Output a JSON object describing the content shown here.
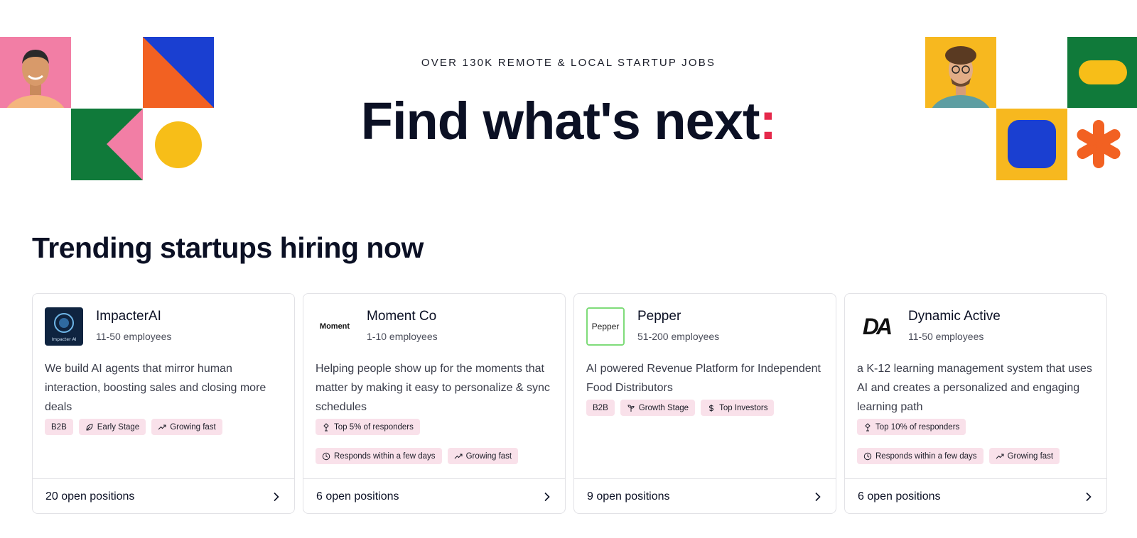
{
  "hero": {
    "eyebrow": "OVER 130K REMOTE & LOCAL STARTUP JOBS",
    "title": "Find what's next",
    "title_colon": ":",
    "accent_color": "#e5294b"
  },
  "section": {
    "title": "Trending startups hiring now"
  },
  "cards": [
    {
      "name": "ImpacterAI",
      "size": "11-50 employees",
      "logo_text": "Impacter AI",
      "description": "We build AI agents that mirror human interaction, boosting sales and closing more deals",
      "tags": [
        {
          "icon": "none",
          "label": "B2B"
        },
        {
          "icon": "leaf-icon",
          "label": "Early Stage"
        },
        {
          "icon": "trending-up-icon",
          "label": "Growing fast"
        }
      ],
      "open_positions": "20 open positions"
    },
    {
      "name": "Moment Co",
      "size": "1-10 employees",
      "logo_text": "Moment",
      "description": "Helping people show up for the moments that matter by making it easy to personalize & sync schedules",
      "tags": [
        {
          "icon": "award-icon",
          "label": "Top 5% of responders"
        },
        {
          "icon": "clock-icon",
          "label": "Responds within a few days"
        },
        {
          "icon": "trending-up-icon",
          "label": "Growing fast"
        }
      ],
      "open_positions": "6 open positions"
    },
    {
      "name": "Pepper",
      "size": "51-200 employees",
      "logo_text": "Pepper",
      "description": "AI powered Revenue Platform for Independent Food Distributors",
      "tags": [
        {
          "icon": "none",
          "label": "B2B"
        },
        {
          "icon": "sprout-icon",
          "label": "Growth Stage"
        },
        {
          "icon": "dollar-icon",
          "label": "Top Investors"
        }
      ],
      "open_positions": "9 open positions"
    },
    {
      "name": "Dynamic Active",
      "size": "11-50 employees",
      "logo_text": "DA",
      "description": "a K-12 learning management system that uses AI and creates a personalized and engaging learning path",
      "tags": [
        {
          "icon": "award-icon",
          "label": "Top 10% of responders"
        },
        {
          "icon": "clock-icon",
          "label": "Responds within a few days"
        },
        {
          "icon": "trending-up-icon",
          "label": "Growing fast"
        }
      ],
      "open_positions": "6 open positions"
    }
  ]
}
